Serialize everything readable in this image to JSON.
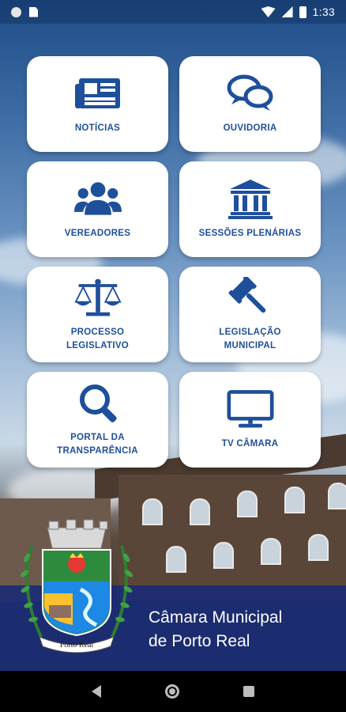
{
  "status_bar": {
    "time": "1:33"
  },
  "menu": [
    {
      "id": "noticias",
      "label": "NOTÍCIAS",
      "icon": "newspaper-icon"
    },
    {
      "id": "ouvidoria",
      "label": "OUVIDORIA",
      "icon": "chat-bubbles-icon"
    },
    {
      "id": "vereadores",
      "label": "VEREADORES",
      "icon": "users-icon"
    },
    {
      "id": "sessoes",
      "label": "SESSÕES PLENÁRIAS",
      "icon": "institution-icon"
    },
    {
      "id": "processo",
      "label": "PROCESSO LEGISLATIVO",
      "icon": "balance-scale-icon"
    },
    {
      "id": "legislacao",
      "label": "LEGISLAÇÃO MUNICIPAL",
      "icon": "gavel-icon"
    },
    {
      "id": "portal",
      "label": "PORTAL DA TRANSPARÊNCIA",
      "icon": "magnifier-icon"
    },
    {
      "id": "tv",
      "label": "TV CÂMARA",
      "icon": "monitor-icon"
    }
  ],
  "footer": {
    "line1": "Câmara Municipal",
    "line2": "de Porto Real",
    "crest_text": "Porto Real"
  },
  "colors": {
    "accent": "#1e4f9b",
    "footer_band": "#182a78"
  }
}
